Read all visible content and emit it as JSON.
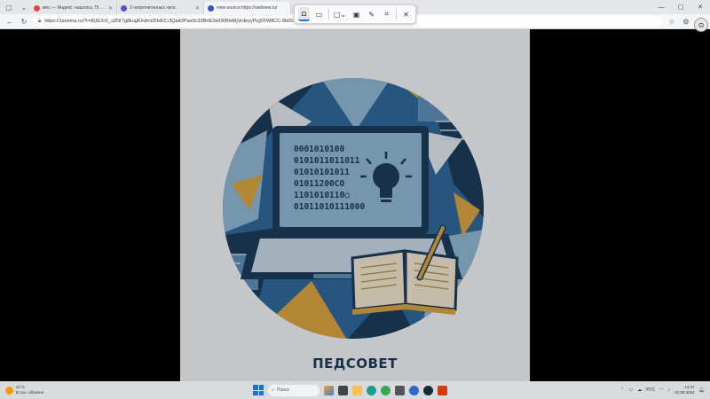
{
  "browser": {
    "tabs": [
      {
        "title": "мес — Яндекс: нашлось 75 млн",
        "color": "#e4453a",
        "active": false
      },
      {
        "title": "2 непрочитанных чата",
        "color": "#5a4fcf",
        "active": false
      },
      {
        "title": "view-source:https://webnew.ru/",
        "color": "#3a4fd0",
        "active": true
      }
    ],
    "url": "https://1snema.ru/?r=8UE2c6_sZNITg8kuglOrdmi2NxKCr3Qa43Pae9c33BrtE3e6WRtxMjVrdeyyPojDFW8CC-8b65..."
  },
  "snip_toolbar": {
    "buttons": [
      {
        "name": "screenshot-mode-button",
        "icon": "camera-icon",
        "glyph": "◘",
        "selected": true
      },
      {
        "name": "video-mode-button",
        "icon": "video-icon",
        "glyph": "▭",
        "selected": false
      },
      {
        "name": "shape-select-button",
        "icon": "rectangle-icon",
        "glyph": "▢⌄",
        "selected": false
      },
      {
        "name": "window-mode-button",
        "icon": "window-capture-icon",
        "glyph": "▣",
        "selected": false
      },
      {
        "name": "pen-button",
        "icon": "pen-icon",
        "glyph": "✎",
        "selected": false
      },
      {
        "name": "text-extract-button",
        "icon": "text-scan-icon",
        "glyph": "⌗",
        "selected": false
      },
      {
        "name": "close-snip-button",
        "icon": "close-icon",
        "glyph": "✕",
        "selected": false
      }
    ]
  },
  "page": {
    "binary_lines": [
      "0001010100",
      "0101011011011",
      "01010101011",
      "01011200CO",
      "1101010110○",
      "01011010111000"
    ],
    "brand": "ПЕДСОВЕТ"
  },
  "taskbar": {
    "weather_temp": "21°C",
    "weather_desc": "В осн. облачно",
    "search_placeholder": "Поиск",
    "lang": "РУС",
    "time": "13:37",
    "date": "22.08.2024"
  },
  "colors": {
    "navy": "#1d3c5c",
    "blue": "#3f79a6",
    "light_blue": "#8fb7d3",
    "gold": "#d9a441"
  }
}
